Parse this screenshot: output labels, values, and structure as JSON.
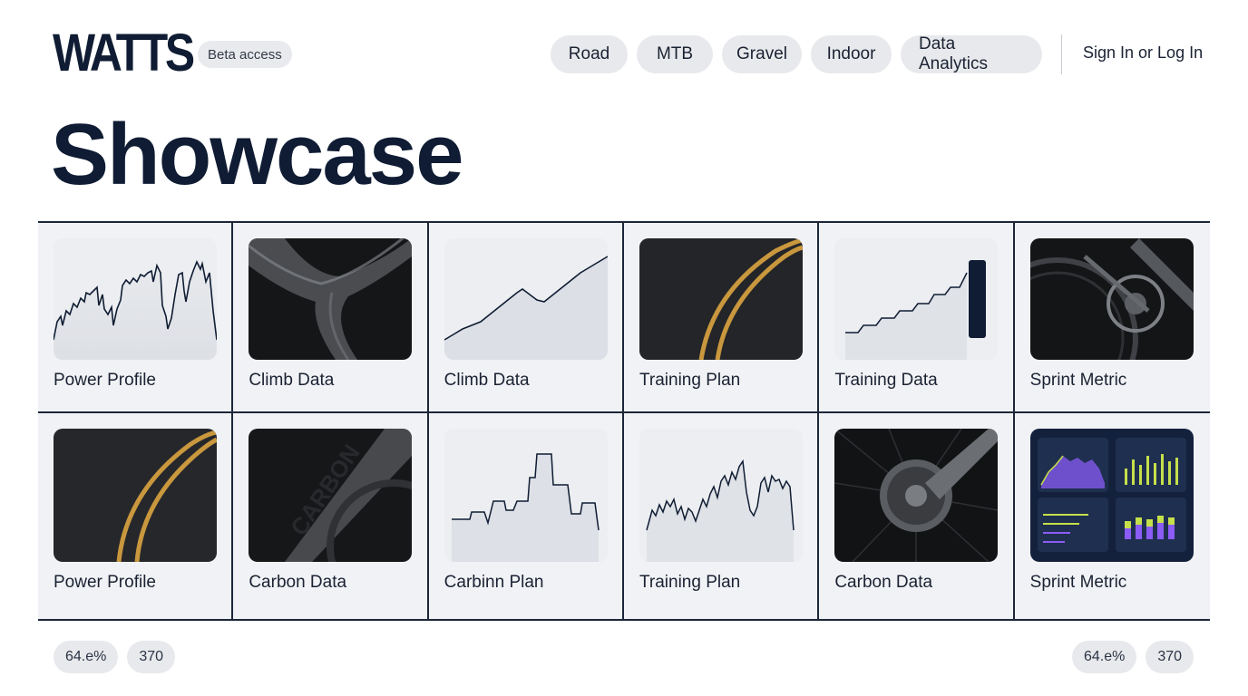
{
  "brand": {
    "name": "WATTS",
    "beta_label": "Beta access"
  },
  "nav": {
    "items": [
      {
        "label": "Road"
      },
      {
        "label": "MTB"
      },
      {
        "label": "Gravel"
      },
      {
        "label": "Indoor"
      },
      {
        "label": "Data Analytics"
      }
    ],
    "signin_label": "Sign In or Log In"
  },
  "page": {
    "title": "Showcase"
  },
  "cards": [
    {
      "label": "Power Profile",
      "thumb_icon": "power-line-chart"
    },
    {
      "label": "Climb Data",
      "thumb_icon": "carbon-frame-photo"
    },
    {
      "label": "Climb Data",
      "thumb_icon": "climb-line-chart"
    },
    {
      "label": "Training Plan",
      "thumb_icon": "road-photo"
    },
    {
      "label": "Training Data",
      "thumb_icon": "step-chart"
    },
    {
      "label": "Sprint Metric",
      "thumb_icon": "drivetrain-photo"
    },
    {
      "label": "Power Profile",
      "thumb_icon": "road-photo"
    },
    {
      "label": "Carbon Data",
      "thumb_icon": "carbon-frame-photo",
      "frame_text": "CARBON"
    },
    {
      "label": "Carbinn Plan",
      "thumb_icon": "step-chart"
    },
    {
      "label": "Training Plan",
      "thumb_icon": "power-line-chart"
    },
    {
      "label": "Carbon Data",
      "thumb_icon": "disc-brake-photo"
    },
    {
      "label": "Sprint Metric",
      "thumb_icon": "dashboard-screenshot"
    }
  ],
  "footer": {
    "left": [
      "64.e%",
      "370"
    ],
    "right": [
      "64.e%",
      "370"
    ]
  },
  "colors": {
    "navy": "#0f1c33",
    "pill_bg": "#e8e9ec",
    "grid_bg": "#f1f2f5",
    "road_stripe": "#c9973d",
    "dash_purple": "#8b5cf6",
    "dash_lime": "#c6e04a"
  }
}
